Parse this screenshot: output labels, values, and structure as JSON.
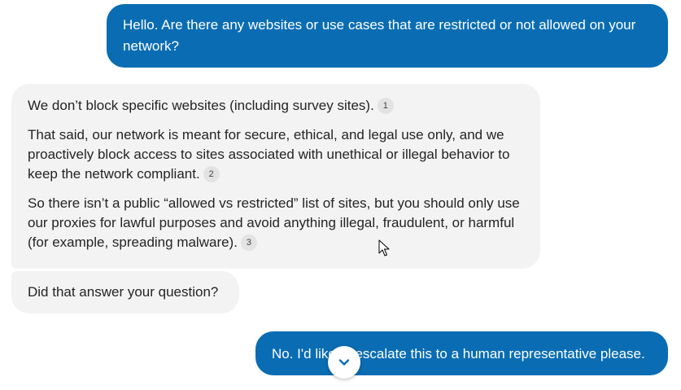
{
  "messages": {
    "user_1": "Hello. Are there any websites or use cases that are restricted or not allowed on your network?",
    "bot_1": {
      "p1": "We don’t block specific websites (including survey sites).",
      "p1_cite": "1",
      "p2": "That said, our network is meant for secure, ethical, and legal use only, and we proactively block access to sites associated with unethical or illegal behavior to keep the network compliant.",
      "p2_cite": "2",
      "p3": "So there isn’t a public “allowed vs restricted” list of sites, but you should only use our proxies for lawful purposes and avoid anything illegal, fraudulent, or harmful (for example, spreading malware).",
      "p3_cite": "3"
    },
    "bot_2": "Did that answer your question?",
    "user_2": "No. I'd like to escalate this to a human representative please."
  },
  "controls": {
    "scroll_down_icon": "chevron-down-icon"
  },
  "colors": {
    "user_bubble": "#0a6db3",
    "bot_bubble": "#f3f3f3",
    "scroll_chevron": "#0a6db3"
  }
}
